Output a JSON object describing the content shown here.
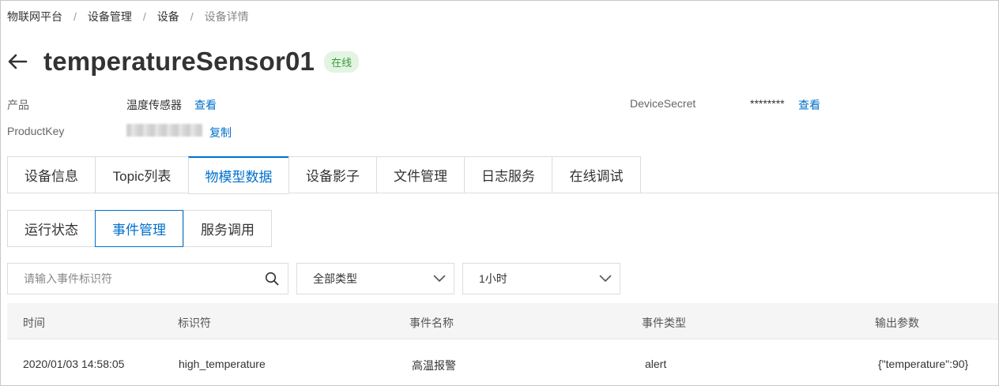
{
  "breadcrumb": {
    "items": [
      "物联网平台",
      "设备管理",
      "设备"
    ],
    "current": "设备详情",
    "separator": "/"
  },
  "header": {
    "back_icon": "arrow-left-icon",
    "title": "temperatureSensor01",
    "status": "在线"
  },
  "info": {
    "product_label": "产品",
    "product_value": "温度传感器",
    "product_link": "查看",
    "secret_label": "DeviceSecret",
    "secret_value": "********",
    "secret_link": "查看",
    "productkey_label": "ProductKey",
    "productkey_link": "复制"
  },
  "tabs": [
    "设备信息",
    "Topic列表",
    "物模型数据",
    "设备影子",
    "文件管理",
    "日志服务",
    "在线调试"
  ],
  "active_tab": "物模型数据",
  "subtabs": [
    "运行状态",
    "事件管理",
    "服务调用"
  ],
  "active_subtab": "事件管理",
  "filters": {
    "search_placeholder": "请输入事件标识符",
    "search_value": "",
    "search_icon": "search-icon",
    "type_select": "全部类型",
    "time_select": "1小时",
    "chevron_icon": "chevron-down-icon"
  },
  "table": {
    "columns": [
      "时间",
      "标识符",
      "事件名称",
      "事件类型",
      "输出参数"
    ],
    "rows": [
      [
        "2020/01/03 14:58:05",
        "high_temperature",
        "高温报警",
        "alert",
        "{\"temperature\":90}"
      ]
    ]
  },
  "colors": {
    "accent": "#0070cc",
    "online_bg": "#e3f4e3",
    "online_text": "#3a9a3a",
    "border": "#dcdcdc",
    "table_header_bg": "#f5f5f5"
  }
}
